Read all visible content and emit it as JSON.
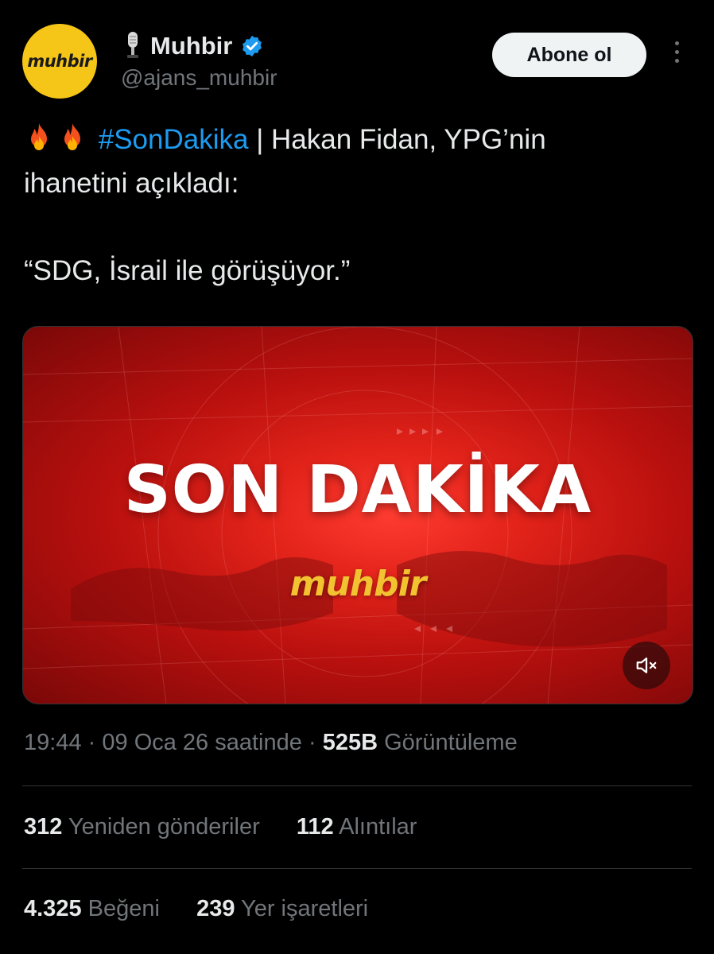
{
  "account": {
    "avatar_text": "muhbir",
    "display_name": "Muhbir",
    "handle": "@ajans_muhbir",
    "follow_label": "Abone ol"
  },
  "tweet": {
    "hashtag": "#SonDakika",
    "text_after_hashtag": " | Hakan Fidan, YPG’nin",
    "line2": "ihanetini açıkladı:",
    "quote": "“SDG, İsrail ile görüşüyor.”"
  },
  "media": {
    "headline": "SON DAKİKA",
    "logo_text": "muhbir"
  },
  "meta": {
    "time": "19:44",
    "sep": "·",
    "date": "09 Oca 26 saatinde",
    "views_count": "525B",
    "views_label": "Görüntüleme"
  },
  "stats": {
    "reposts_count": "312",
    "reposts_label": "Yeniden gönderiler",
    "quotes_count": "112",
    "quotes_label": "Alıntılar",
    "likes_count": "4.325",
    "likes_label": "Beğeni",
    "bookmarks_count": "239",
    "bookmarks_label": "Yer işaretleri"
  },
  "colors": {
    "background": "#000000",
    "link": "#1d9bf0",
    "secondary_text": "#71767b",
    "avatar_bg": "#f5c518",
    "media_red": "#e2231a"
  },
  "icons": [
    "microphone-icon",
    "verified-badge-icon",
    "more-options-icon",
    "fire-emoji-icon",
    "mute-icon"
  ]
}
